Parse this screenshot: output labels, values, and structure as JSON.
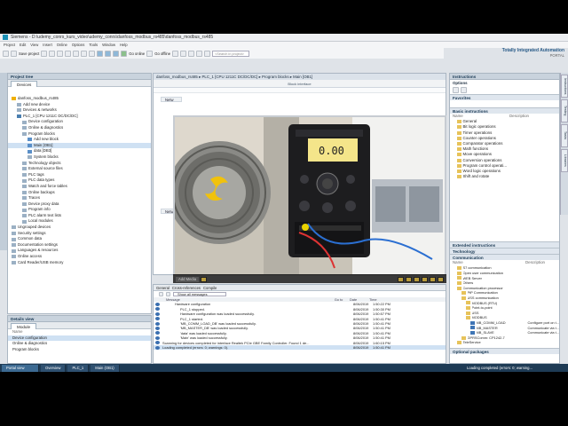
{
  "title": "Siemens - D:\\udemy_conrs_kurs_video\\udemy_conrs\\danfoss_modbus_rs485\\danfoss_modbus_rs485",
  "menu": [
    "Project",
    "Edit",
    "View",
    "Insert",
    "Online",
    "Options",
    "Tools",
    "Window",
    "Help"
  ],
  "toolbar": {
    "save": "Save project",
    "go_online": "Go online",
    "go_offline": "Go offline",
    "search_placeholder": "<Search in project>"
  },
  "brand": {
    "line1": "Totally Integrated Automation",
    "line2": "PORTAL"
  },
  "project_tree": {
    "header": "Project tree",
    "tab": "Devices",
    "items": [
      "danfoss_modbus_rs485",
      "Add new device",
      "Devices & networks",
      "PLC_1 [CPU 1211C DC/DC/DC]",
      "Device configuration",
      "Online & diagnostics",
      "Program blocks",
      "Add new block",
      "Main [OB1]",
      "data [DB3]",
      "System blocks",
      "Technology objects",
      "External source files",
      "PLC tags",
      "PLC data types",
      "Watch and force tables",
      "Online backups",
      "Traces",
      "Device proxy data",
      "Program info",
      "PLC alarm text lists",
      "Local modules",
      "Ungrouped devices",
      "Security settings",
      "Common data",
      "Documentation settings",
      "Languages & resources",
      "Online access",
      "Card Reader/USB memory"
    ]
  },
  "details_view": {
    "header": "Details view",
    "tab": "Module",
    "column": "Name",
    "items": [
      "Device configuration",
      "Online & diagnostics",
      "Program blocks"
    ]
  },
  "editor": {
    "breadcrumb": "danfoss_modbus_rs485 ▸ PLC_1 [CPU 1211C DC/DC/DC] ▸ Program blocks ▸ Main [OB1]",
    "block_interface": "Block interface",
    "network_label": "Netw"
  },
  "video": {
    "label": "Add Media"
  },
  "properties": {
    "tabs": [
      "General",
      "Cross-references",
      "Compile"
    ],
    "filter": "Show all messages",
    "columns": [
      "Message",
      "Go to",
      "Date",
      "Time"
    ],
    "rows": [
      [
        "Hardware configuration",
        "",
        "8/06/2019",
        "1:50:22 PM"
      ],
      [
        "PLC_1 stopped.",
        "",
        "8/06/2019",
        "1:50:30 PM"
      ],
      [
        "Hardware configuration was loaded successfully.",
        "",
        "8/06/2019",
        "1:50:57 PM"
      ],
      [
        "PLC_1 started.",
        "",
        "8/06/2019",
        "1:50:41 PM"
      ],
      [
        "'MB_COMM_LOAD_DB' was loaded successfully.",
        "",
        "8/06/2019",
        "1:50:41 PM"
      ],
      [
        "'MB_MASTER_DB' was loaded successfully.",
        "",
        "8/06/2019",
        "1:50:41 PM"
      ],
      [
        "'data' was loaded successfully.",
        "",
        "8/06/2019",
        "1:50:41 PM"
      ],
      [
        "'Main' was loaded successfully.",
        "",
        "8/06/2019",
        "1:50:41 PM"
      ],
      [
        "Scanning for devices completed for interface Realtek PCIe GBE Family Controller. Found 1 de...",
        "",
        "8/06/2019",
        "1:60:15 PM"
      ],
      [
        "Loading completed (errors: 0; warnings: 0).",
        "",
        "8/06/2019",
        "1:50:41 PM"
      ]
    ]
  },
  "instructions": {
    "header": "Instructions",
    "options": "Options",
    "favorites": "Favorites",
    "basic": "Basic instructions",
    "columns": [
      "Name",
      "Description"
    ],
    "basic_items": [
      "General",
      "Bit logic operations",
      "Timer operations",
      "Counter operations",
      "Comparator operations",
      "Math functions",
      "Move operations",
      "Conversion operations",
      "Program control operati...",
      "Word logic operations",
      "Shift and rotate"
    ],
    "extended": "Extended instructions",
    "technology": "Technology",
    "communication": "Communication",
    "comm_columns": [
      "Name",
      "Description"
    ],
    "comm_items": [
      [
        "S7 communication",
        ""
      ],
      [
        "Open user communication",
        ""
      ],
      [
        "WEB Server",
        ""
      ],
      [
        "Others",
        ""
      ],
      [
        "Communication processor",
        ""
      ],
      [
        "PtP Communication",
        ""
      ],
      [
        "USS communication",
        ""
      ],
      [
        "MODBUS (RTU)",
        ""
      ],
      [
        "Point-to-point",
        ""
      ],
      [
        "USS",
        ""
      ],
      [
        "MODBUS",
        ""
      ],
      [
        "MB_COMM_LOAD",
        "Configure port on t..."
      ],
      [
        "MB_MASTER",
        "Communicate via t..."
      ],
      [
        "MB_SLAVE",
        "Communicate via t..."
      ],
      [
        "GPRSComm: CP1242-7",
        ""
      ],
      [
        "TeleService",
        ""
      ]
    ],
    "optional": "Optional packages"
  },
  "vtabs": [
    "Instructions",
    "Testing",
    "Tasks",
    "Libraries"
  ],
  "statusbar": {
    "portal": "Portal view",
    "tabs": [
      "Overview",
      "PLC_1",
      "Main (OB1)"
    ],
    "status": "Loading completed (errors: 0; warning..."
  }
}
